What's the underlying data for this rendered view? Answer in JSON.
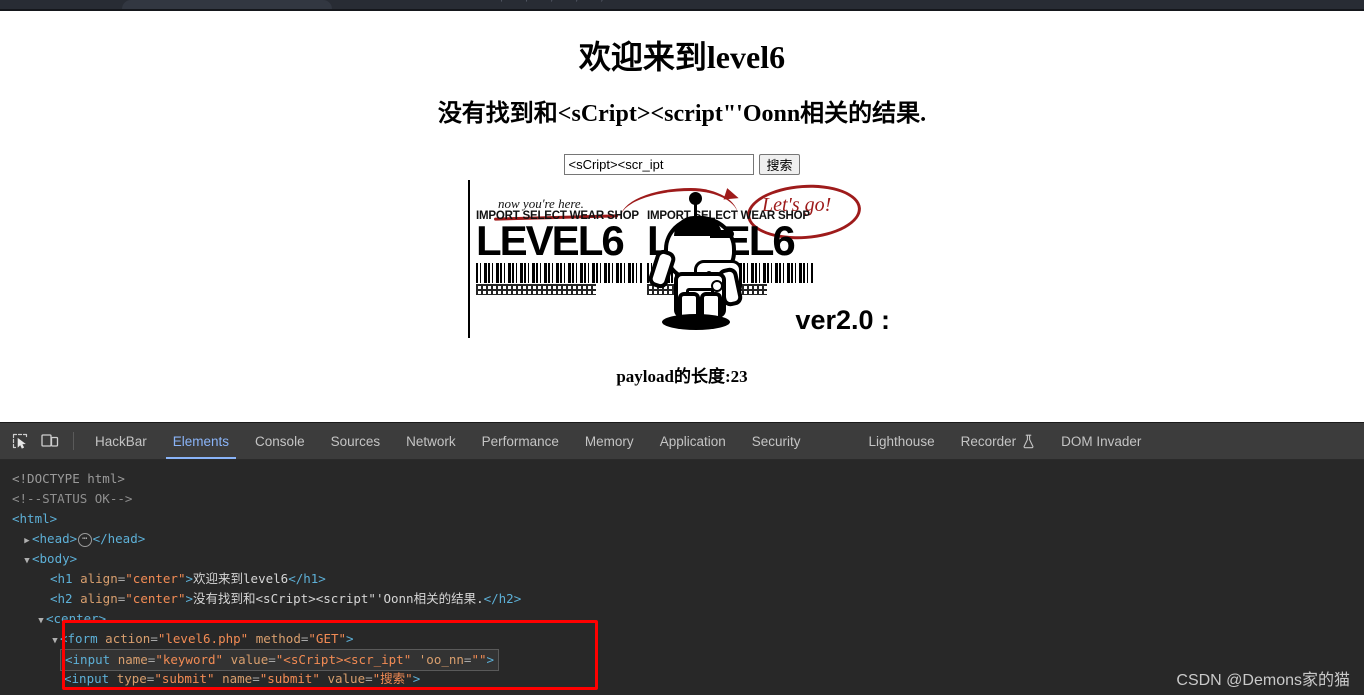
{
  "chrome": {
    "tab_ghost_label": ""
  },
  "page": {
    "h1": "欢迎来到level6",
    "h2": "没有找到和<sCript><script\"'Oonn相关的结果.",
    "search": {
      "value": "<sCript><scr_ipt",
      "placeholder": "",
      "button_label": "搜索"
    },
    "banner": {
      "note": "now you're here.",
      "callout": "Let's go!",
      "shop_left": "IMPORT SELECT WEAR SHOP",
      "level_left": "LEVEL6",
      "shop_right": "IMPORT SELECT WEAR SHOP",
      "level_right": "LEVEL6",
      "version": "ver2.0 :"
    },
    "payload_length": "payload的长度:23"
  },
  "devtools": {
    "icons": {
      "inspect": "inspect-element-icon",
      "device": "device-toolbar-icon"
    },
    "tabs": [
      {
        "label": "HackBar",
        "active": false
      },
      {
        "label": "Elements",
        "active": true
      },
      {
        "label": "Console",
        "active": false
      },
      {
        "label": "Sources",
        "active": false
      },
      {
        "label": "Network",
        "active": false
      },
      {
        "label": "Performance",
        "active": false
      },
      {
        "label": "Memory",
        "active": false
      },
      {
        "label": "Application",
        "active": false
      },
      {
        "label": "Security",
        "active": false
      },
      {
        "label": "Lighthouse",
        "active": false
      },
      {
        "label": "Recorder",
        "active": false,
        "icon": "flask-icon"
      },
      {
        "label": "DOM Invader",
        "active": false
      }
    ],
    "tree": {
      "doctype": "<!DOCTYPE html>",
      "comment": "<!--STATUS OK-->",
      "html_open": "<html>",
      "head_open": "<head>",
      "head_close": "</head>",
      "body_open": "<body>",
      "h1": {
        "tag_open": "<h1",
        "attr_name": "align",
        "attr_value": "\"center\"",
        "gt": ">",
        "text": "欢迎来到level6",
        "tag_close": "</h1>"
      },
      "h2": {
        "tag_open": "<h2",
        "attr_name": "align",
        "attr_value": "\"center\"",
        "gt": ">",
        "text": "没有找到和<sCript><script\"'Oonn相关的结果.",
        "tag_close": "</h2>"
      },
      "center_open": "<center>",
      "form": {
        "tag_open": "<form",
        "attr1_name": "action",
        "attr1_value": "\"level6.php\"",
        "attr2_name": "method",
        "attr2_value": "\"GET\"",
        "gt": ">"
      },
      "input_keyword": {
        "tag_open": "<input",
        "attr1_name": "name",
        "attr1_value": "\"keyword\"",
        "attr2_name": "value",
        "attr2_value": "\"<sCript><scr_ipt\"",
        "attr3_name": "'oo_nn",
        "attr3_value": "\"\"",
        "gt": ">"
      },
      "input_submit": {
        "tag_open": "<input",
        "attr1_name": "type",
        "attr1_value": "\"submit\"",
        "attr2_name": "name",
        "attr2_value": "\"submit\"",
        "attr3_name": "value",
        "attr3_value": "\"搜索\"",
        "gt": ">"
      }
    }
  },
  "watermark": "CSDN @Demons家的猫",
  "colors": {
    "devtools_bg": "#282828",
    "toolbar_bg": "#3c3c3c",
    "active_tab": "#8ab4f8",
    "highlight_box": "#ff0000",
    "tag": "#5db0d7",
    "attr": "#d99f6e",
    "value": "#f28b54"
  }
}
